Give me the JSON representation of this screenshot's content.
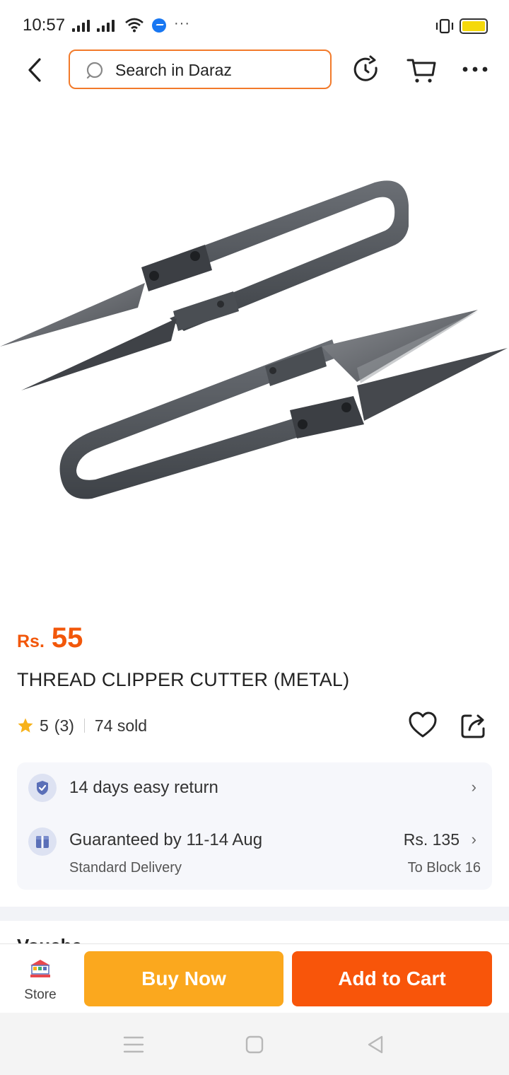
{
  "status_bar": {
    "time": "10:57",
    "more": "···",
    "battery_color": "#f5d90a"
  },
  "top_nav": {
    "search_placeholder": "Search in Daraz",
    "accent": "#f27a2a"
  },
  "product": {
    "currency": "Rs.",
    "price": "55",
    "title": "THREAD CLIPPER CUTTER (METAL)",
    "rating": "5",
    "rating_count": "(3)",
    "sold": "74 sold",
    "price_color": "#f2570a"
  },
  "services": {
    "return_text": "14 days easy return",
    "delivery_text": "Guaranteed by 11-14 Aug",
    "delivery_type": "Standard Delivery",
    "delivery_price": "Rs. 135",
    "delivery_area": "To Block 16"
  },
  "section_heading": "Vouchers",
  "action_bar": {
    "store_label": "Store",
    "buy_now": "Buy Now",
    "add_to_cart": "Add to Cart",
    "buy_color": "#fba81e",
    "cart_color": "#f8550a"
  },
  "icons": [
    "back-icon",
    "search-icon",
    "history-icon",
    "cart-icon",
    "more-icon",
    "star-icon",
    "heart-icon",
    "share-icon",
    "shield-check-icon",
    "delivery-box-icon",
    "chevron-right-icon",
    "menu-icon",
    "home-icon",
    "back-triangle-icon"
  ]
}
